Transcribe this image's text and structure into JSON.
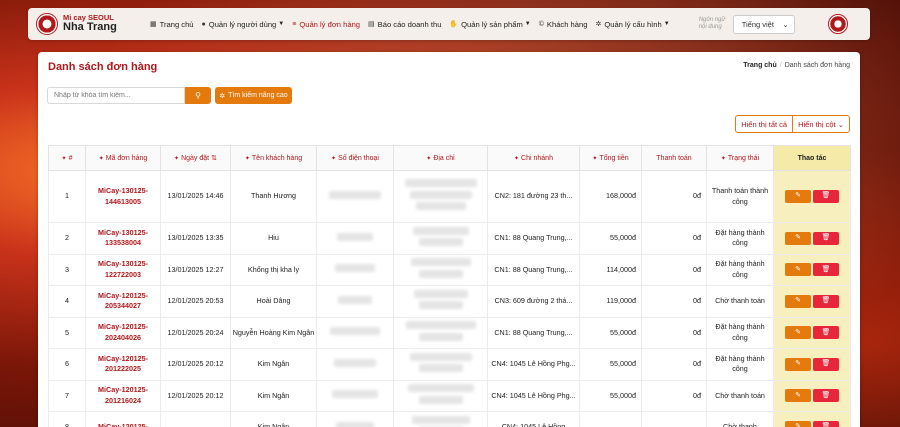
{
  "brand": {
    "line1": "Mi cay SEOUL",
    "line2": "Nha Trang"
  },
  "nav": {
    "items": [
      {
        "label": "Trang chủ",
        "icon": "dashboard-icon"
      },
      {
        "label": "Quản lý người dùng",
        "icon": "user-icon"
      },
      {
        "label": "Quản lý đơn hàng",
        "icon": "list-icon"
      },
      {
        "label": "Báo cáo doanh thu",
        "icon": "file-icon"
      },
      {
        "label": "Quản lý sản phẩm",
        "icon": "hand-icon"
      },
      {
        "label": "Khách hàng",
        "icon": "copyright-icon"
      },
      {
        "label": "Quản lý cấu hình",
        "icon": "gear-icon"
      }
    ],
    "lang_label": "Ngôn ngữ nội dung",
    "lang_value": "Tiếng việt"
  },
  "page": {
    "title": "Danh sách đơn hàng",
    "breadcrumb": [
      "Trang chủ",
      "Danh sách đơn hàng"
    ],
    "search_placeholder": "Nhập từ khóa tìm kiếm...",
    "adv_search": "Tìm kiếm nâng cao",
    "show_all": "Hiển thị tất cả",
    "show_cols": "Hiển thị cột"
  },
  "table": {
    "headers": [
      "#",
      "Mã đơn hàng",
      "Ngày đặt",
      "Tên khách hàng",
      "Số điện thoại",
      "Địa chỉ",
      "Chi nhánh",
      "Tổng tiền",
      "Thanh toán",
      "Trạng thái",
      "Thao tác"
    ],
    "rows": [
      {
        "no": "1",
        "code": "MiCay-130125-144613005",
        "date": "13/01/2025 14:46",
        "name": "Thanh Hương",
        "branch": "CN2: 181 đường 23 th...",
        "total": "168,000đ",
        "paid": "0đ",
        "status": "Thanh toán thành công"
      },
      {
        "no": "2",
        "code": "MiCay-130125-133538004",
        "date": "13/01/2025 13:35",
        "name": "Hiu",
        "branch": "CN1: 88 Quang Trung,...",
        "total": "55,000đ",
        "paid": "0đ",
        "status": "Đặt hàng thành công"
      },
      {
        "no": "3",
        "code": "MiCay-130125-122722003",
        "date": "13/01/2025 12:27",
        "name": "Khổng thị kha ly",
        "branch": "CN1: 88 Quang Trung,...",
        "total": "114,000đ",
        "paid": "0đ",
        "status": "Đặt hàng thành công"
      },
      {
        "no": "4",
        "code": "MiCay-120125-205344027",
        "date": "12/01/2025 20:53",
        "name": "Hoài Dâng",
        "branch": "CN3: 609 đường 2 thá...",
        "total": "119,000đ",
        "paid": "0đ",
        "status": "Chờ thanh toán"
      },
      {
        "no": "5",
        "code": "MiCay-120125-202404026",
        "date": "12/01/2025 20:24",
        "name": "Nguyễn Hoàng Kim Ngân",
        "branch": "CN1: 88 Quang Trung,...",
        "total": "55,000đ",
        "paid": "0đ",
        "status": "Đặt hàng thành công"
      },
      {
        "no": "6",
        "code": "MiCay-120125-201222025",
        "date": "12/01/2025 20:12",
        "name": "Kim Ngân",
        "branch": "CN4: 1045 Lê Hồng Phg...",
        "total": "55,000đ",
        "paid": "0đ",
        "status": "Đặt hàng thành công"
      },
      {
        "no": "7",
        "code": "MiCay-120125-201216024",
        "date": "12/01/2025 20:12",
        "name": "Kim Ngân",
        "branch": "CN4: 1045 Lê Hồng Phg...",
        "total": "55,000đ",
        "paid": "0đ",
        "status": "Chờ thanh toán"
      },
      {
        "no": "8",
        "code": "MiCay-120125-",
        "date": "",
        "name": "Kim Ngân",
        "branch": "CN4: 1045 Lê Hồng",
        "total": "",
        "paid": "",
        "status": "Chờ thanh"
      }
    ]
  },
  "colors": {
    "brand_red": "#b0181c",
    "accent_orange": "#e47a0c",
    "delete_red": "#e8263a",
    "action_col": "#f5eaa8"
  }
}
